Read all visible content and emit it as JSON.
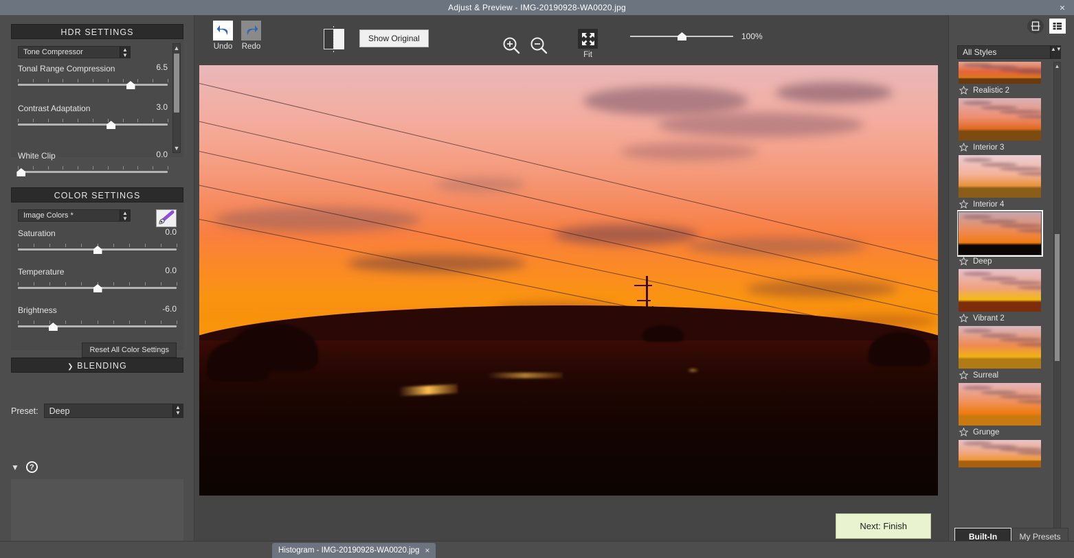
{
  "window": {
    "title": "Adjust & Preview - IMG-20190928-WA0020.jpg",
    "close_label": "×"
  },
  "hdr_settings": {
    "header": "HDR SETTINGS",
    "method": "Tone Compressor",
    "sliders": [
      {
        "label": "Tonal Range Compression",
        "value": "6.5",
        "pct": 75
      },
      {
        "label": "Contrast Adaptation",
        "value": "3.0",
        "pct": 62
      },
      {
        "label": "White Clip",
        "value": "0.0",
        "pct": 2
      }
    ]
  },
  "color_settings": {
    "header": "COLOR SETTINGS",
    "profile": "Image Colors *",
    "brush_icon": "paintbrush-icon",
    "sliders": [
      {
        "label": "Saturation",
        "value": "0.0",
        "pct": 50
      },
      {
        "label": "Temperature",
        "value": "0.0",
        "pct": 50
      },
      {
        "label": "Brightness",
        "value": "-6.0",
        "pct": 22
      }
    ],
    "reset_label": "Reset All Color Settings"
  },
  "blending": {
    "header": "BLENDING",
    "chevron": "❯"
  },
  "preset": {
    "label": "Preset:",
    "value": "Deep"
  },
  "help": {
    "chevron_icon": "chevron-down-icon",
    "help_icon": "question-mark-icon",
    "help_glyph": "?"
  },
  "toolbar": {
    "undo_label": "Undo",
    "redo_label": "Redo",
    "show_original_label": "Show Original",
    "split_view_icon": "split-view-icon",
    "zoom_in_icon": "zoom-in-icon",
    "zoom_out_icon": "zoom-out-icon",
    "fit_label": "Fit",
    "fit_icon": "fit-to-screen-icon",
    "zoom_percent": "100%",
    "zoom_slider_pct": 50
  },
  "preview": {
    "description": "Sunset landscape with power lines, pylon and silhouetted hills"
  },
  "next_button": {
    "label": "Next: Finish"
  },
  "histogram_tab": {
    "label": "Histogram - IMG-20190928-WA0020.jpg",
    "close": "×"
  },
  "styles_panel": {
    "view_modes": [
      {
        "name": "filmstrip-view-icon",
        "active": false
      },
      {
        "name": "grid-view-icon",
        "active": true
      }
    ],
    "filter": "All Styles",
    "items": [
      {
        "name": "Realistic 2",
        "selected": false,
        "partial": true,
        "sky_top": "#e3a58f",
        "sky_mid": "#e8643c",
        "sky_low": "#d9771b",
        "ground": "#6b3a0c"
      },
      {
        "name": "Interior 3",
        "selected": false,
        "partial": false,
        "sky_top": "#d9b2b6",
        "sky_mid": "#ef8e70",
        "sky_low": "#e06a22",
        "ground": "#7d4a10"
      },
      {
        "name": "Interior 4",
        "selected": false,
        "partial": false,
        "sky_top": "#eccfd3",
        "sky_mid": "#f3b39a",
        "sky_low": "#e9923a",
        "ground": "#8a5d18"
      },
      {
        "name": "Deep",
        "selected": true,
        "partial": false,
        "sky_top": "#c4a6b0",
        "sky_mid": "#ef8a55",
        "sky_low": "#f07a12",
        "ground": "#0b0503"
      },
      {
        "name": "Vibrant 2",
        "selected": false,
        "partial": false,
        "sky_top": "#e6c2cd",
        "sky_mid": "#f0a27e",
        "sky_low": "#f2bb12",
        "ground": "#7e2d0b"
      },
      {
        "name": "Surreal",
        "selected": false,
        "partial": false,
        "sky_top": "#d9b8c2",
        "sky_mid": "#ef8a52",
        "sky_low": "#f0b215",
        "ground": "#b07a14"
      },
      {
        "name": "Grunge",
        "selected": false,
        "partial": false,
        "sky_top": "#e4b5bd",
        "sky_mid": "#f09159",
        "sky_low": "#f07a0e",
        "ground": "#c87a10"
      },
      {
        "name": "",
        "selected": false,
        "partial": true,
        "sky_top": "#e9c3c8",
        "sky_mid": "#f0a884",
        "sky_low": "#ef9a3a",
        "ground": "#a8600f"
      }
    ],
    "tabs": [
      {
        "label": "Built-In",
        "active": true
      },
      {
        "label": "My Presets",
        "active": false
      }
    ]
  },
  "colors": {
    "titlebar": "#6c7480",
    "panel_bg": "#4d4d4d",
    "section_header_bg": "#2b2b2b",
    "accent_button": "#e9f3cf",
    "text": "#e4e4e4"
  }
}
